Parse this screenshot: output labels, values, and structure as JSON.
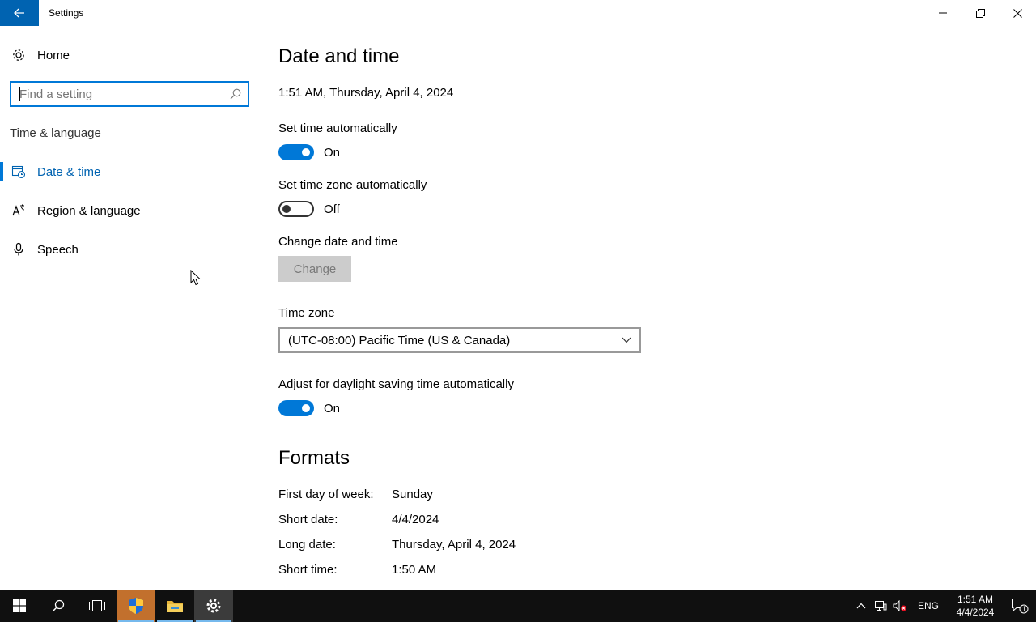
{
  "window": {
    "title": "Settings"
  },
  "sidebar": {
    "home_label": "Home",
    "search_placeholder": "Find a setting",
    "section_title": "Time & language",
    "items": [
      {
        "label": "Date & time",
        "icon": "calendar-clock-icon",
        "active": true
      },
      {
        "label": "Region & language",
        "icon": "language-icon",
        "active": false
      },
      {
        "label": "Speech",
        "icon": "microphone-icon",
        "active": false
      }
    ]
  },
  "main": {
    "title": "Date and time",
    "current_datetime": "1:51 AM, Thursday, April 4, 2024",
    "set_time_auto": {
      "label": "Set time automatically",
      "state": "On"
    },
    "set_tz_auto": {
      "label": "Set time zone automatically",
      "state": "Off"
    },
    "change_dt": {
      "label": "Change date and time",
      "button": "Change"
    },
    "timezone": {
      "label": "Time zone",
      "value": "(UTC-08:00) Pacific Time (US & Canada)"
    },
    "dst": {
      "label": "Adjust for daylight saving time automatically",
      "state": "On"
    },
    "formats": {
      "title": "Formats",
      "rows": [
        {
          "key": "First day of week:",
          "value": "Sunday"
        },
        {
          "key": "Short date:",
          "value": "4/4/2024"
        },
        {
          "key": "Long date:",
          "value": "Thursday, April 4, 2024"
        },
        {
          "key": "Short time:",
          "value": "1:50 AM"
        }
      ]
    }
  },
  "taskbar": {
    "language": "ENG",
    "clock_time": "1:51 AM",
    "clock_date": "4/4/2024",
    "notification_count": "1"
  },
  "colors": {
    "accent": "#0078d7",
    "title_back": "#0063b1",
    "taskbar": "#101010"
  }
}
